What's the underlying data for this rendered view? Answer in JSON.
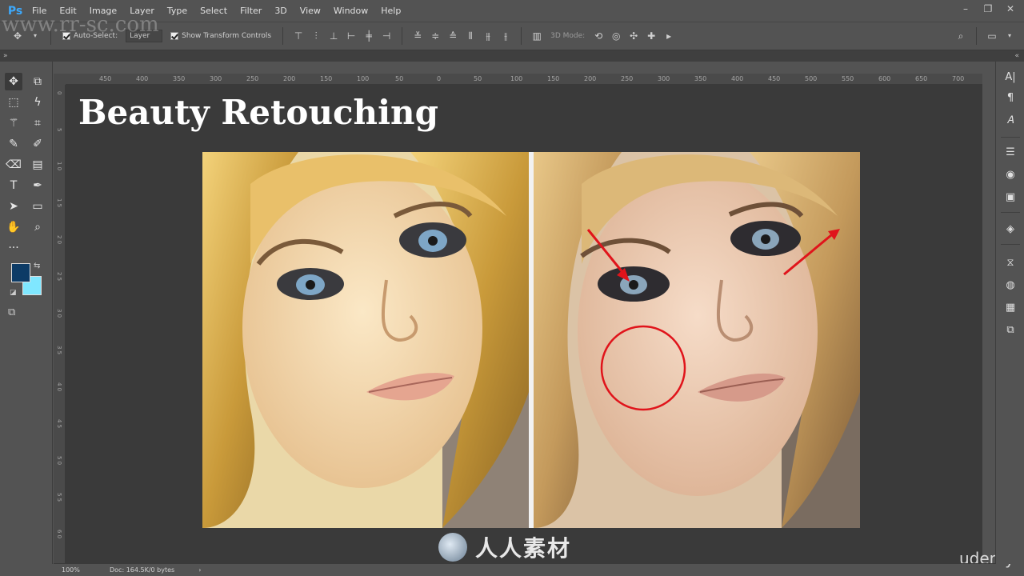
{
  "app": {
    "logo": "Ps",
    "menu": [
      "File",
      "Edit",
      "Image",
      "Layer",
      "Type",
      "Select",
      "Filter",
      "3D",
      "View",
      "Window",
      "Help"
    ],
    "window_controls": [
      "minimize-icon",
      "restore-icon",
      "close-icon"
    ]
  },
  "options_bar": {
    "auto_select_label": "Auto-Select:",
    "auto_select_value": "Layer",
    "show_transform_label": "Show Transform Controls",
    "mode_label": "3D Mode:"
  },
  "rulers": {
    "top": [
      "450",
      "400",
      "350",
      "300",
      "250",
      "200",
      "150",
      "100",
      "50",
      "0",
      "50",
      "100",
      "150",
      "200",
      "250",
      "300",
      "350",
      "400",
      "450",
      "500",
      "550",
      "600",
      "650",
      "700"
    ],
    "left": [
      "0",
      "5",
      "1 0",
      "1 5",
      "2 0",
      "2 5",
      "3 0",
      "3 5",
      "4 0",
      "4 5",
      "5 0",
      "5 5",
      "6 0"
    ]
  },
  "canvas": {
    "title": "Beauty Retouching"
  },
  "colors": {
    "foreground": "#0d3b66",
    "background": "#7fe7ff",
    "annotation": "#e0141b"
  },
  "watermarks": {
    "site": "www.rr-sc.com",
    "brand": "人人素材",
    "udemy": "udemy"
  },
  "status": {
    "zoom": "100%",
    "doc": "Doc: 164.5K/0 bytes"
  }
}
